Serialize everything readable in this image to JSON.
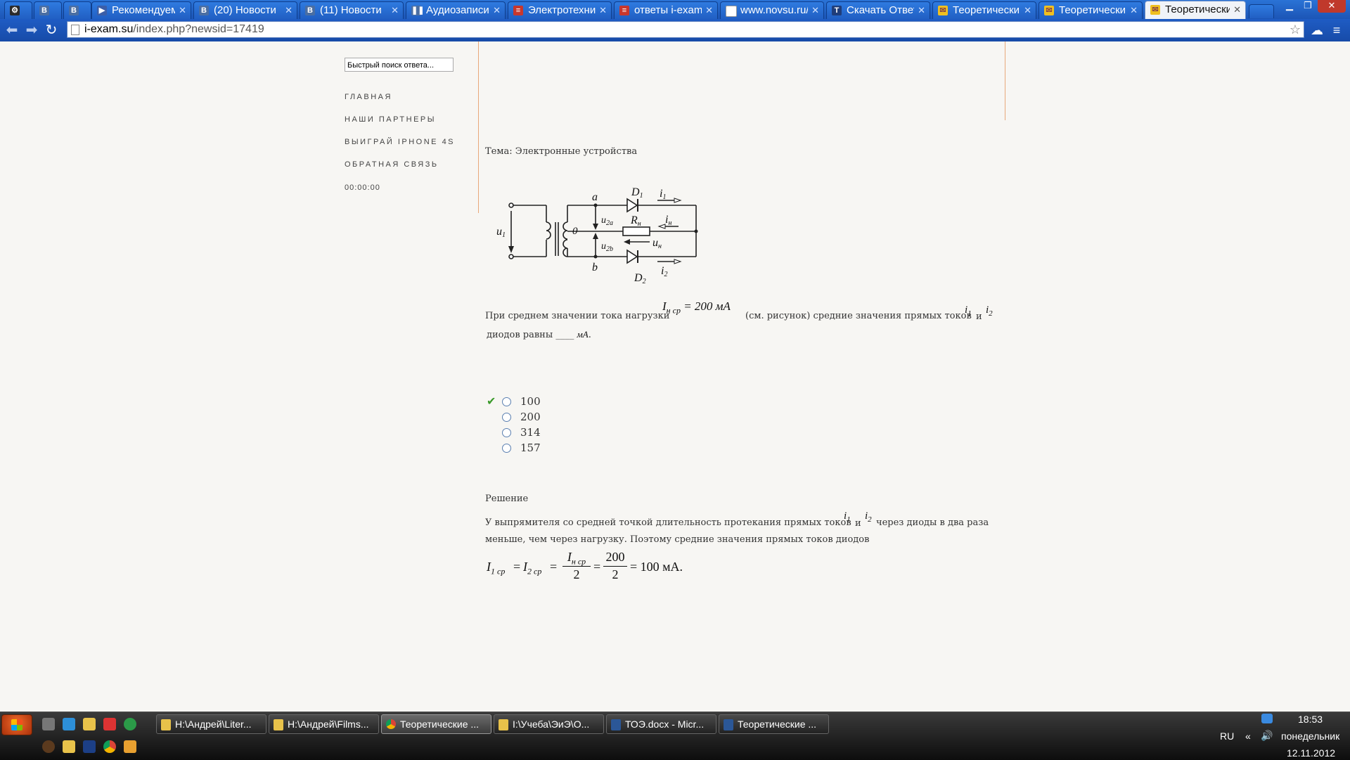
{
  "browser": {
    "tabs": [
      {
        "label": "",
        "icon": "gear-icon"
      },
      {
        "label": "",
        "icon": "vk-icon"
      },
      {
        "label": "",
        "icon": "vk-icon"
      },
      {
        "label": "Рекомендуемые",
        "icon": "play-icon"
      },
      {
        "label": "(20) Новости",
        "icon": "vk-icon"
      },
      {
        "label": "(11) Новости",
        "icon": "vk-icon"
      },
      {
        "label": "Аудиозаписи",
        "icon": "pause-icon"
      },
      {
        "label": "Электротехни",
        "icon": "doc-icon"
      },
      {
        "label": "ответы i-exam",
        "icon": "doc-icon"
      },
      {
        "label": "www.novsu.ru/",
        "icon": "page-icon"
      },
      {
        "label": "Скачать Ответ",
        "icon": "t-icon"
      },
      {
        "label": "Теоретически",
        "icon": "mail-icon"
      },
      {
        "label": "Теоретически",
        "icon": "mail-icon"
      },
      {
        "label": "Теоретически",
        "icon": "mail-icon"
      }
    ],
    "url_domain": "i-exam.su",
    "url_path": "/index.php?newsid=17419"
  },
  "sidebar": {
    "search_value": "Быстрый поиск ответа...",
    "menu": [
      "ГЛАВНАЯ",
      "НАШИ ПАРТНЕРЫ",
      "ВЫИГРАЙ IPHONE 4S",
      "ОБРАТНАЯ СВЯЗЬ"
    ],
    "timer": "00:00:00"
  },
  "content": {
    "topic": "Тема: Электронные устройства",
    "question_part1": "При среднем значении тока нагрузки",
    "question_formula": "I",
    "question_formula_sub": "н ср",
    "question_formula_rest": " = 200 мА",
    "question_part2": "(см. рисунок) средние значения прямых токов",
    "i1": "i",
    "i1_sub": "1",
    "and": "и",
    "i2": "i",
    "i2_sub": "2",
    "question_part3": "диодов равны ____",
    "unit": "мА",
    "dot": ".",
    "answers": [
      "100",
      "200",
      "314",
      "157"
    ],
    "solution_title": "Решение",
    "solution_part1": "У выпрямителя со средней точкой длительность протекания прямых токов",
    "solution_part2": "через диоды в два раза",
    "solution_line2": "меньше, чем через нагрузку. Поэтому средние значения прямых токов диодов",
    "formula": {
      "lhs1": "I",
      "lhs1_sub": "1 ср",
      "eq": "=",
      "lhs2": "I",
      "lhs2_sub": "2 ср",
      "frac1_num": "I",
      "frac1_num_sub": "н ср",
      "frac1_den": "2",
      "frac2_num": "200",
      "frac2_den": "2",
      "result": "= 100 мА."
    },
    "circuit": {
      "u1": "u",
      "u1_sub": "1",
      "a": "a",
      "b": "b",
      "zero": "0",
      "D1": "D",
      "D1_sub": "1",
      "D2": "D",
      "D2_sub": "2",
      "i1": "i",
      "i1_sub": "1",
      "i2": "i",
      "i2_sub": "2",
      "in": "i",
      "in_sub": "н",
      "Rn": "R",
      "Rn_sub": "н",
      "un": "u",
      "un_sub": "н",
      "u2a": "u",
      "u2a_sub": "2a",
      "u2b": "u",
      "u2b_sub": "2b"
    }
  },
  "taskbar": {
    "tasks": [
      "H:\\Андрей\\Liter...",
      "H:\\Андрей\\Films...",
      "Теоретические ...",
      "I:\\Учеба\\ЭиЭ\\О...",
      "ТОЭ.docx - Micr...",
      "Теоретические ..."
    ],
    "lang": "RU",
    "chevron": "«",
    "time": "18:53",
    "day": "понедельник",
    "date": "12.11.2012"
  }
}
